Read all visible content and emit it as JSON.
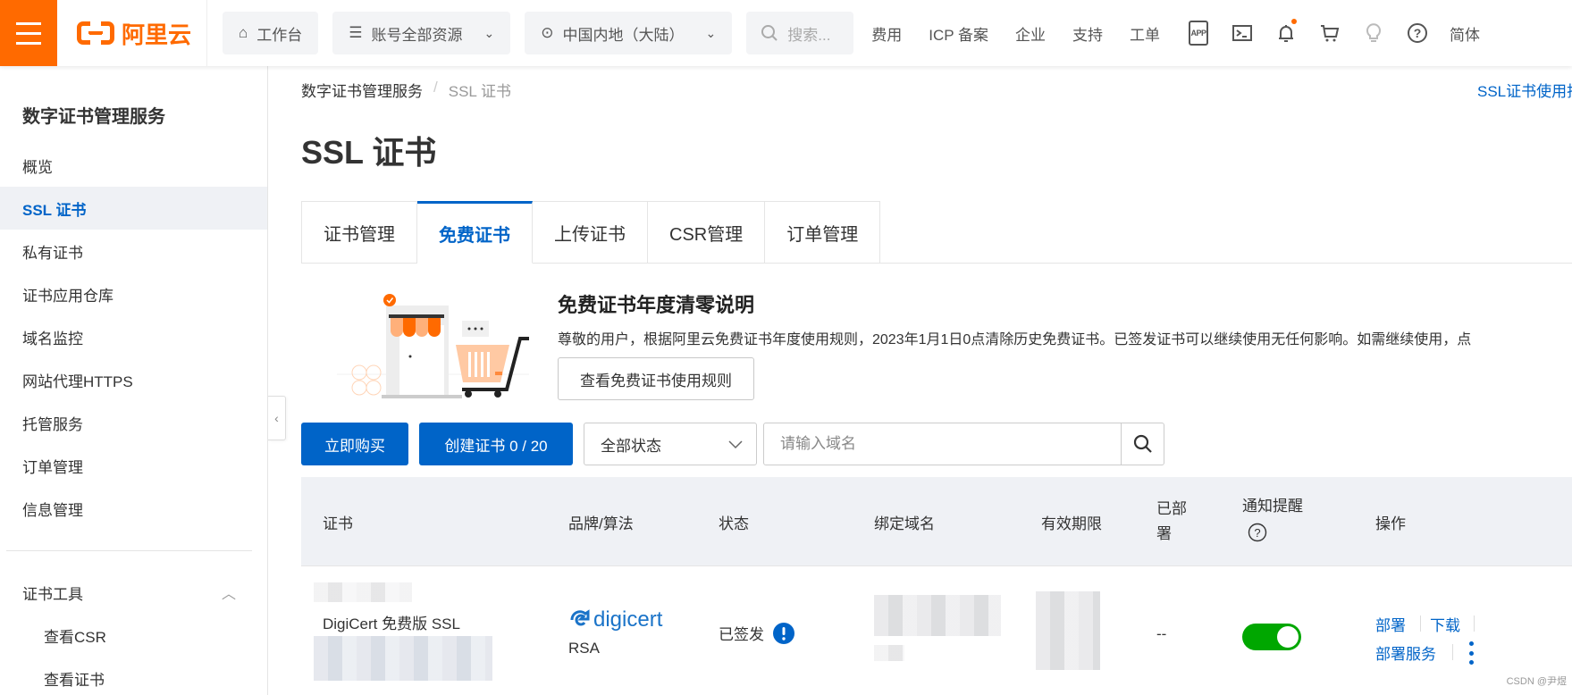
{
  "topbar": {
    "logo_text": "阿里云",
    "workbench": "工作台",
    "resources": "账号全部资源",
    "region": "中国内地（大陆）",
    "search_placeholder": "搜索...",
    "links": [
      "费用",
      "ICP 备案",
      "企业",
      "支持",
      "工单"
    ],
    "icons": [
      "app-icon",
      "terminal-icon",
      "bell-icon",
      "cart-icon",
      "lightbulb-icon",
      "help-icon"
    ],
    "notification_dot_color": "#ff6a00",
    "language": "简体"
  },
  "sidebar": {
    "title": "数字证书管理服务",
    "items": [
      {
        "label": "概览"
      },
      {
        "label": "SSL 证书",
        "active": true
      },
      {
        "label": "私有证书"
      },
      {
        "label": "证书应用仓库"
      },
      {
        "label": "域名监控"
      },
      {
        "label": "网站代理HTTPS"
      },
      {
        "label": "托管服务"
      },
      {
        "label": "订单管理"
      },
      {
        "label": "信息管理"
      }
    ],
    "group": {
      "label": "证书工具",
      "expanded": true,
      "items": [
        {
          "label": "查看CSR"
        },
        {
          "label": "查看证书"
        }
      ]
    }
  },
  "main": {
    "breadcrumb": [
      "数字证书管理服务",
      "SSL 证书"
    ],
    "breadcrumb_sep": "/",
    "doc_link": "SSL证书使用指南",
    "title": "SSL 证书",
    "tabs": [
      {
        "label": "证书管理"
      },
      {
        "label": "免费证书",
        "active": true
      },
      {
        "label": "上传证书"
      },
      {
        "label": "CSR管理"
      },
      {
        "label": "订单管理"
      }
    ],
    "banner": {
      "title": "免费证书年度清零说明",
      "text": "尊敬的用户，根据阿里云免费证书年度使用规则，2023年1月1日0点清除历史免费证书。已签发证书可以继续使用无任何影响。如需继续使用，点",
      "button": "查看免费证书使用规则"
    },
    "toolbar": {
      "buy": "立即购买",
      "create": "创建证书 0 / 20",
      "status_select": "全部状态",
      "domain_placeholder": "请输入域名"
    },
    "table": {
      "headers": [
        "证书",
        "品牌/算法",
        "状态",
        "绑定域名",
        "有效期限",
        "已部署",
        "通知提醒",
        "操作"
      ],
      "rows": [
        {
          "certificate": "DigiCert 免费版 SSL",
          "brand": "digicert",
          "algorithm": "RSA",
          "status": "已签发",
          "deployed": "--",
          "notify_on": true,
          "actions": [
            "部署",
            "下载",
            "部署服务"
          ]
        }
      ]
    },
    "accent_color": "#0064c8",
    "toggle_color": "#00a700"
  },
  "watermark": "CSDN @尹煜"
}
